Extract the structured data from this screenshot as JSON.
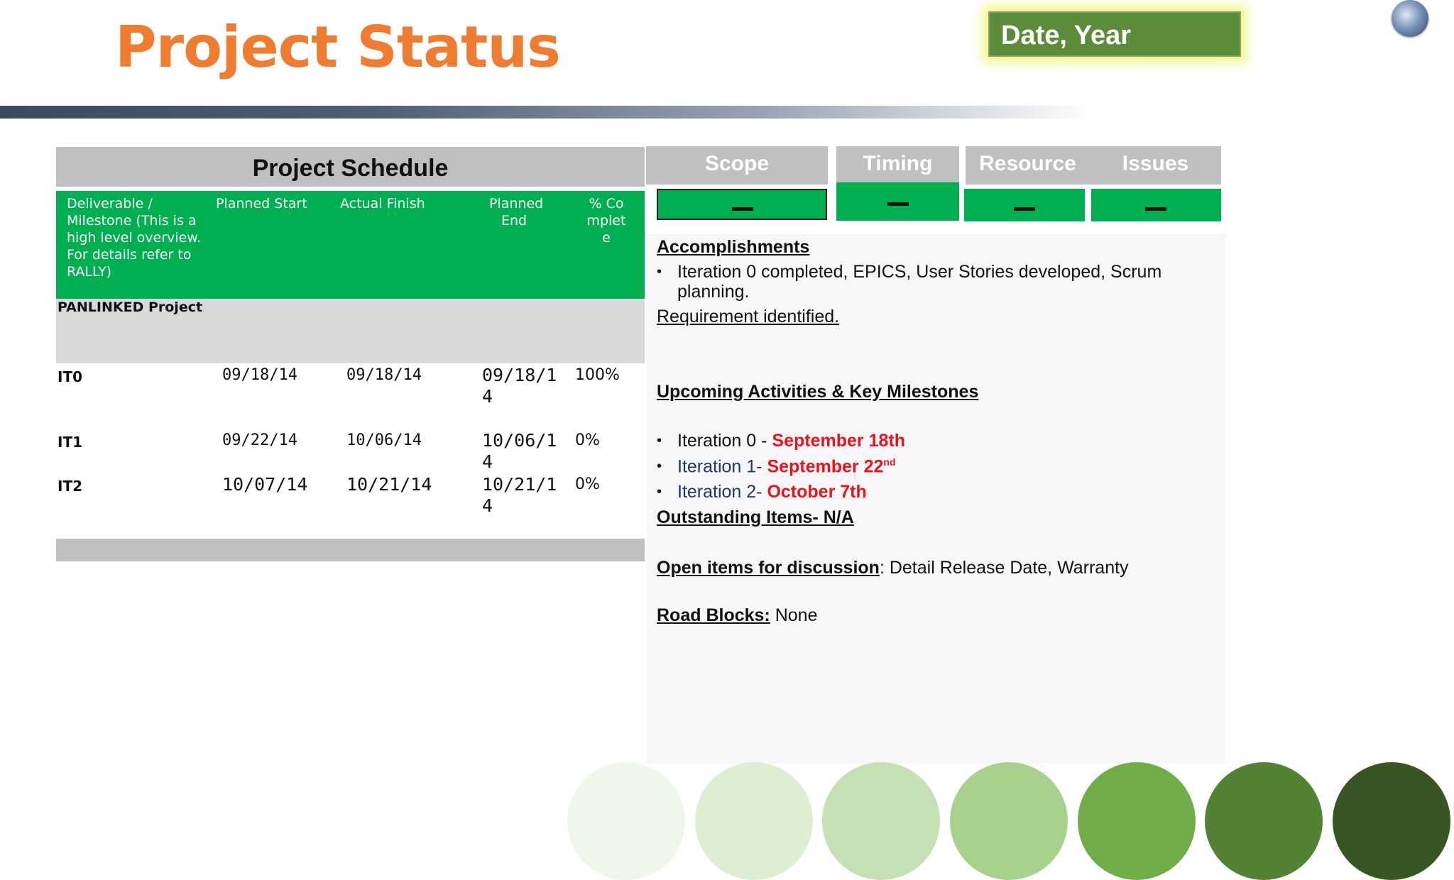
{
  "header": {
    "title": "Project Status",
    "date_label": "Date, Year"
  },
  "schedule": {
    "title": "Project Schedule",
    "columns": {
      "deliverable": "Deliverable / Milestone (This is a high level overview. For details refer to RALLY)",
      "planned_start": "Planned Start",
      "actual_finish": "Actual Finish",
      "planned_end": "Planned End",
      "pct_complete": "% Complete"
    },
    "project_name": "PANLINKED Project",
    "rows": [
      {
        "name": "IT0",
        "planned_start": "09/18/14",
        "actual_finish": "09/18/14",
        "planned_end": "09/18/14",
        "pct": "100%"
      },
      {
        "name": "IT1",
        "planned_start": "09/22/14",
        "actual_finish": "10/06/14",
        "planned_end": "10/06/14",
        "pct": "0%"
      },
      {
        "name": "IT2",
        "planned_start": "10/07/14",
        "actual_finish": "10/21/14",
        "planned_end": "10/21/14",
        "pct": "0%"
      }
    ]
  },
  "status": {
    "scope": "Scope",
    "timing": "Timing",
    "resource": "Resource",
    "issues": "Issues",
    "status_color": "#00b050",
    "indicator": "–"
  },
  "accomplishments": {
    "heading": "Accomplishments",
    "bullet_1": "Iteration 0 completed, EPICS, User Stories developed, Scrum planning.",
    "requirement": "Requirement identified."
  },
  "upcoming": {
    "heading": "Upcoming Activities & Key Milestones",
    "items": [
      {
        "label": "Iteration 0 - ",
        "date": "September 18th"
      },
      {
        "label": "Iteration 1- ",
        "date": "September 22",
        "sup": "nd"
      },
      {
        "label": "Iteration 2- ",
        "date": "October 7th"
      }
    ]
  },
  "outstanding": {
    "heading": "Outstanding Items- N/A"
  },
  "open_items": {
    "heading": "Open items for discussion",
    "text": ": Detail Release Date, Warranty"
  },
  "road_blocks": {
    "heading": "Road Blocks:",
    "text": " None"
  },
  "colors": {
    "title_orange": "#ee7d31",
    "date_green": "#5b8c3a",
    "table_green": "#00b050",
    "milestone_red": "#e8141c",
    "circle_palette": [
      "#eef7ea",
      "#ddeed2",
      "#c5e0b3",
      "#a9d18e",
      "#70ad47",
      "#548235",
      "#375623"
    ]
  }
}
